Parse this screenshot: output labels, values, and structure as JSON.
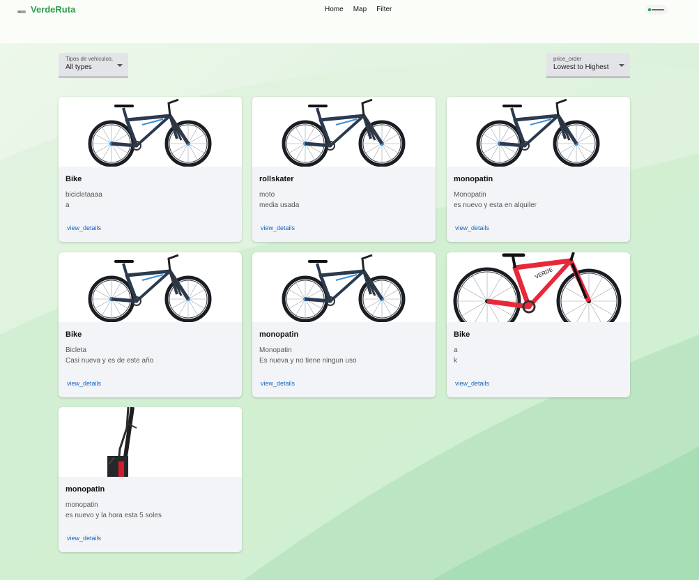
{
  "header": {
    "brand_name": "VerdeRuta",
    "nav": [
      "Home",
      "Map",
      "Filter"
    ]
  },
  "filters": {
    "type": {
      "label": "Tipos de vehiculos.",
      "value": "All types"
    },
    "price": {
      "label": "price_order",
      "value": "Lowest to Highest"
    }
  },
  "cards": [
    {
      "title": "Bike",
      "line1": "bicicletaaaa",
      "line2": "a",
      "link": "view_details",
      "image": "mountain-bike-blue"
    },
    {
      "title": "rollskater",
      "line1": "moto",
      "line2": "media usada",
      "link": "view_details",
      "image": "mountain-bike-blue"
    },
    {
      "title": "monopatin",
      "line1": "Monopatin",
      "line2": "es nuevo y esta en alquiler",
      "link": "view_details",
      "image": "mountain-bike-blue"
    },
    {
      "title": "Bike",
      "line1": "Bicleta",
      "line2": "Casi nueva y es de este año",
      "link": "view_details",
      "image": "mountain-bike-blue"
    },
    {
      "title": "monopatin",
      "line1": "Monopatin",
      "line2": "Es nueva y no tiene ningun uso",
      "link": "view_details",
      "image": "mountain-bike-blue"
    },
    {
      "title": "Bike",
      "line1": "a",
      "line2": "k",
      "link": "view_details",
      "image": "mountain-bike-red"
    },
    {
      "title": "monopatin",
      "line1": "monopatin",
      "line2": "es nuevo y la hora esta 5 soles",
      "link": "view_details",
      "image": "scooter-stem"
    }
  ],
  "colors": {
    "brand": "#2e9e4f",
    "link": "#1565c0",
    "card": "#f3f4f7"
  }
}
